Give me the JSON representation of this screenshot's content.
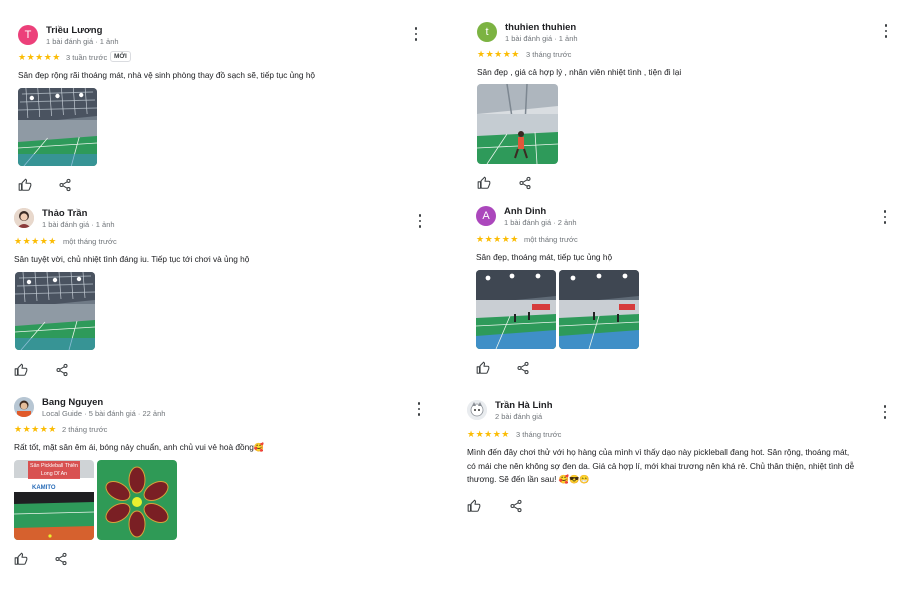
{
  "reviews": [
    {
      "name": "Triều Lương",
      "avatar_letter": "T",
      "avatar_color": "#ec407a",
      "meta": "1 bài đánh giá · 1 ảnh",
      "stars": "★★★★★",
      "time": "3 tuần trước",
      "badge": "MỚI",
      "text": "Sân đẹp rộng rãi thoáng mát, nhà vệ sinh phòng thay đồ sạch sẽ, tiếp tục ủng hộ"
    },
    {
      "name": "thuhien thuhien",
      "avatar_letter": "t",
      "avatar_color": "#7cb342",
      "meta": "1 bài đánh giá · 1 ảnh",
      "stars": "★★★★★",
      "time": "3 tháng trước",
      "text": "Sân đẹp , giá cả hợp lý , nhân viên nhiệt tình , tiện đi lại"
    },
    {
      "name": "Thảo Trần",
      "meta": "1 bài đánh giá · 1 ảnh",
      "stars": "★★★★★",
      "time": "một tháng trước",
      "text": "Sân tuyệt vời, chủ nhiệt tình đáng iu. Tiếp tục tới chơi và ủng hộ"
    },
    {
      "name": "Anh Dinh",
      "avatar_letter": "A",
      "avatar_color": "#ab47bc",
      "meta": "1 bài đánh giá · 2 ảnh",
      "stars": "★★★★★",
      "time": "một tháng trước",
      "text": "Sân đẹp, thoáng mát, tiếp tục ủng hộ"
    },
    {
      "name": "Bang Nguyen",
      "meta": "Local Guide · 5 bài đánh giá · 22 ảnh",
      "stars": "★★★★★",
      "time": "2 tháng trước",
      "text": "Rất tốt, mặt sân êm ái, bóng nảy chuẩn, anh chủ vui vẻ hoà đồng🥰",
      "photo_caption_1": "Sân Pickleball Thiên",
      "photo_caption_2": "Long Dĩ An",
      "photo_sign": "KAMITO"
    },
    {
      "name": "Trần Hà Linh",
      "meta": "2 bài đánh giá",
      "stars": "★★★★★",
      "time": "3 tháng trước",
      "text_1": "Mình đến đây chơi thử với họ hàng của mình vì thấy dạo này pickleball đang hot. Sân rộng, thoáng mát,",
      "text_2": "có mái che nên không sợ đen da. Giá cả hợp lí, mới khai trương nên khá rẻ. Chủ thân thiện, nhiệt tình dễ",
      "text_3": "thương. Sẽ đến lần sau! 🥰😎😁"
    }
  ],
  "icons": {
    "like": "thumb-up-icon",
    "share": "share-icon",
    "more": "more-vert-icon"
  },
  "colors": {
    "star": "#fbbc04",
    "meta": "#70757a",
    "court_green": "#2e9a5a"
  }
}
